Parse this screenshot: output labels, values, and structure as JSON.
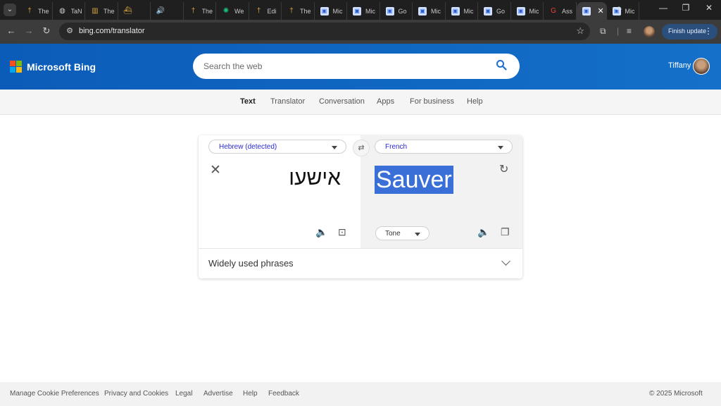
{
  "browser": {
    "tabs": [
      {
        "label": "The",
        "icon": "cross-icon"
      },
      {
        "label": "TaN",
        "icon": "globe-icon"
      },
      {
        "label": "The",
        "icon": "book-icon"
      },
      {
        "label": "",
        "icon": "ship-icon"
      },
      {
        "label": "",
        "icon": "speaker-icon"
      },
      {
        "label": "The",
        "icon": "cross-icon"
      },
      {
        "label": "We",
        "icon": "chatgpt-icon"
      },
      {
        "label": "Edi",
        "icon": "cross-icon"
      },
      {
        "label": "The",
        "icon": "cross-icon"
      },
      {
        "label": "Mic",
        "icon": "translator-icon"
      },
      {
        "label": "Mic",
        "icon": "translator-icon"
      },
      {
        "label": "Go",
        "icon": "translator-icon"
      },
      {
        "label": "Mic",
        "icon": "translator-icon"
      },
      {
        "label": "Mic",
        "icon": "translator-icon"
      },
      {
        "label": "Go",
        "icon": "translator-icon"
      },
      {
        "label": "Mic",
        "icon": "translator-icon"
      },
      {
        "label": "Ass",
        "icon": "google-icon"
      }
    ],
    "active_tab": {
      "label": "Mic",
      "icon": "translator-icon"
    },
    "url": "bing.com/translator",
    "finish_update": "Finish update"
  },
  "header": {
    "brand": "Microsoft Bing",
    "search_placeholder": "Search the web",
    "user_name": "Tiffany"
  },
  "subnav": [
    "Text",
    "Translator",
    "Conversation",
    "Apps",
    "For business",
    "Help"
  ],
  "translator": {
    "source_lang": "Hebrew (detected)",
    "target_lang": "French",
    "source_text": "אישעו",
    "target_text": "Sauver",
    "tone_label": "Tone",
    "phrases_label": "Widely used phrases"
  },
  "footer": {
    "links": [
      "Manage Cookie Preferences",
      "Privacy and Cookies",
      "Legal",
      "Advertise",
      "Help",
      "Feedback"
    ],
    "copyright": "© 2025 Microsoft"
  },
  "colors": {
    "bing_blue": "#0b5cb8",
    "highlight": "#3a6fd8",
    "lang_text": "#2a2ad0"
  }
}
